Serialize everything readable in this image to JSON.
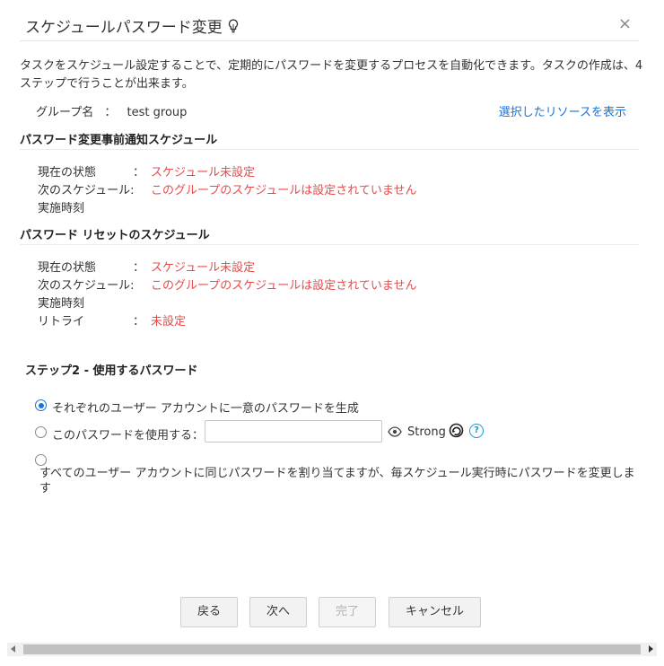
{
  "dialog": {
    "title": "スケジュールパスワード変更",
    "close": "×",
    "description": "タスクをスケジュール設定することで、定期的にパスワードを変更するプロセスを自動化できます。タスクの作成は、4ステップで行うことが出来ます。"
  },
  "group": {
    "label": "グループ名",
    "colon": "：",
    "value": "test group",
    "link": "選択したリソースを表示"
  },
  "notify_section": {
    "title": "パスワード変更事前通知スケジュール",
    "rows": [
      {
        "label": "現在の状態",
        "colon": "：",
        "value": "スケジュール未設定"
      },
      {
        "label": "次のスケジュール:",
        "colon": "",
        "value": "このグループのスケジュールは設定されていません"
      },
      {
        "label": "実施時刻",
        "colon": "",
        "value": ""
      }
    ]
  },
  "reset_section": {
    "title": "パスワード リセットのスケジュール",
    "rows": [
      {
        "label": "現在の状態",
        "colon": "：",
        "value": "スケジュール未設定"
      },
      {
        "label": "次のスケジュール:",
        "colon": "",
        "value": "このグループのスケジュールは設定されていません"
      },
      {
        "label": "実施時刻",
        "colon": "",
        "value": ""
      },
      {
        "label": "リトライ",
        "colon": "：",
        "value": "未設定"
      }
    ]
  },
  "step": {
    "title": "ステップ2 - 使用するパスワード",
    "options": [
      {
        "label": "それぞれのユーザー アカウントに一意のパスワードを生成",
        "checked": true
      },
      {
        "label": "このパスワードを使用する：",
        "checked": false
      },
      {
        "label": "すべてのユーザー アカウントに同じパスワードを割り当てますが、毎スケジュール実行時にパスワードを変更します",
        "checked": false
      }
    ],
    "password_value": "",
    "strength": "Strong",
    "help": "?"
  },
  "buttons": {
    "back": "戻る",
    "next": "次へ",
    "finish": "完了",
    "cancel": "キャンセル"
  },
  "colors": {
    "accent": "#1a73d9",
    "status_red": "#e74c4c",
    "help_blue": "#1a9ad6"
  }
}
